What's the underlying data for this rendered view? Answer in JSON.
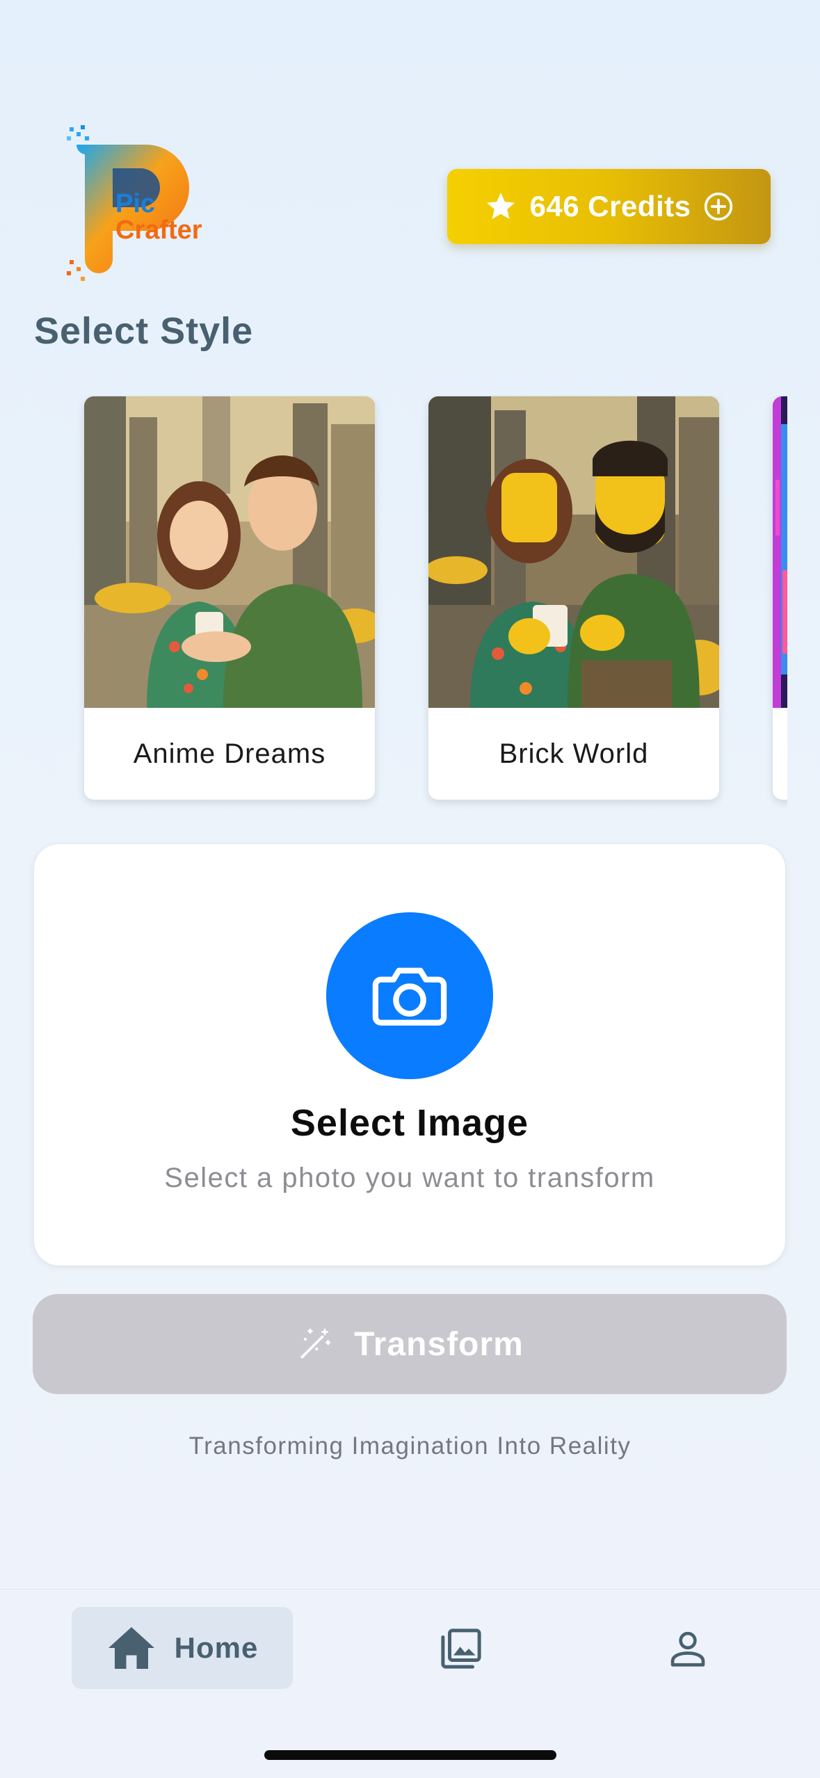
{
  "header": {
    "logo_line1": "Pic",
    "logo_line2": "Crafter",
    "credits_label": "646 Credits"
  },
  "styles_section": {
    "title": "Select Style",
    "items": [
      {
        "label": "Anime Dreams"
      },
      {
        "label": "Brick World"
      },
      {
        "label": ""
      }
    ]
  },
  "upload": {
    "title": "Select Image",
    "subtitle": "Select a photo you want to transform",
    "icon": "camera-icon"
  },
  "transform": {
    "label": "Transform",
    "icon": "magic-wand-icon",
    "enabled": false
  },
  "tagline": "Transforming Imagination Into Reality",
  "tabbar": {
    "items": [
      {
        "label": "Home",
        "icon": "home-icon",
        "active": true
      },
      {
        "label": "",
        "icon": "gallery-icon",
        "active": false
      },
      {
        "label": "",
        "icon": "profile-icon",
        "active": false
      }
    ]
  },
  "colors": {
    "accent_blue": "#0a7cff",
    "credits_gold": "#e8be05",
    "title_slate": "#48606f",
    "disabled_gray": "#c8c8ce"
  }
}
